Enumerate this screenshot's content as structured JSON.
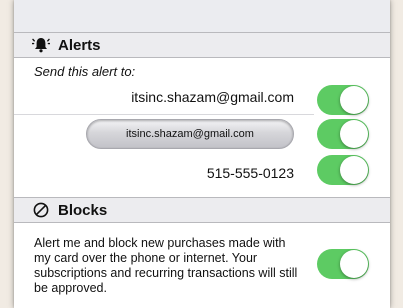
{
  "alerts": {
    "title": "Alerts",
    "subtitle": "Send this alert to:",
    "recipients": [
      {
        "label": "itsinc.shazam@gmail.com",
        "enabled": true
      },
      {
        "label": "itsinc.shazam@gmail.com",
        "enabled": true
      },
      {
        "label": "515-555-0123",
        "enabled": true
      }
    ]
  },
  "blocks": {
    "title": "Blocks",
    "description": "Alert me and block new purchases made with my card over the phone or internet. Your subscriptions and recurring transactions will still be approved.",
    "enabled": true
  },
  "colors": {
    "toggle_on": "#5dcb63",
    "background": "#f1ebe3",
    "header_bg": "#ececef"
  },
  "icons": {
    "alerts": "bell-icon",
    "blocks": "prohibited-icon"
  }
}
